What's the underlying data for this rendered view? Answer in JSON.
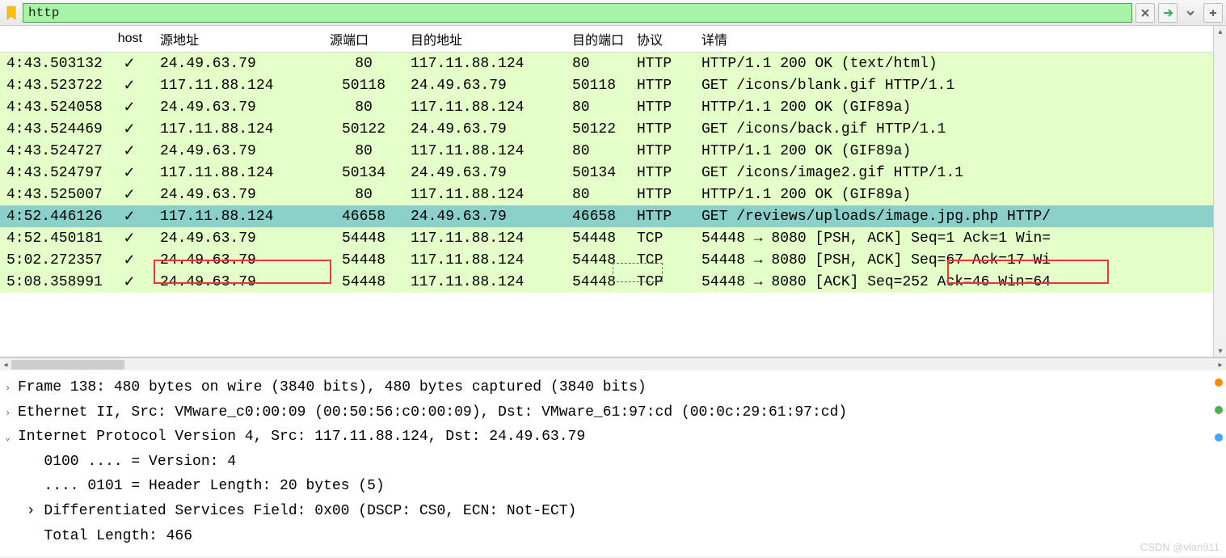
{
  "filter": {
    "value": "http"
  },
  "columns": {
    "time": "",
    "host": "host",
    "src": "源地址",
    "sport": "源端口",
    "dst": "目的地址",
    "dport": "目的端口",
    "proto": "协议",
    "info": "详情"
  },
  "packets": [
    {
      "time": "4:43.503132",
      "host": "✓",
      "src": "24.49.63.79",
      "sport": "80",
      "dst": "117.11.88.124",
      "dport": "80",
      "proto": "HTTP",
      "info": "HTTP/1.1 200 OK  (text/html)",
      "bg": "lightgreen"
    },
    {
      "time": "4:43.523722",
      "host": "✓",
      "src": "117.11.88.124",
      "sport": "50118",
      "dst": "24.49.63.79",
      "dport": "50118",
      "proto": "HTTP",
      "info": "GET /icons/blank.gif HTTP/1.1",
      "bg": "lightgreen"
    },
    {
      "time": "4:43.524058",
      "host": "✓",
      "src": "24.49.63.79",
      "sport": "80",
      "dst": "117.11.88.124",
      "dport": "80",
      "proto": "HTTP",
      "info": "HTTP/1.1 200 OK  (GIF89a)",
      "bg": "lightgreen"
    },
    {
      "time": "4:43.524469",
      "host": "✓",
      "src": "117.11.88.124",
      "sport": "50122",
      "dst": "24.49.63.79",
      "dport": "50122",
      "proto": "HTTP",
      "info": "GET /icons/back.gif HTTP/1.1",
      "bg": "lightgreen"
    },
    {
      "time": "4:43.524727",
      "host": "✓",
      "src": "24.49.63.79",
      "sport": "80",
      "dst": "117.11.88.124",
      "dport": "80",
      "proto": "HTTP",
      "info": "HTTP/1.1 200 OK  (GIF89a)",
      "bg": "lightgreen"
    },
    {
      "time": "4:43.524797",
      "host": "✓",
      "src": "117.11.88.124",
      "sport": "50134",
      "dst": "24.49.63.79",
      "dport": "50134",
      "proto": "HTTP",
      "info": "GET /icons/image2.gif HTTP/1.1",
      "bg": "lightgreen"
    },
    {
      "time": "4:43.525007",
      "host": "✓",
      "src": "24.49.63.79",
      "sport": "80",
      "dst": "117.11.88.124",
      "dport": "80",
      "proto": "HTTP",
      "info": "HTTP/1.1 200 OK  (GIF89a)",
      "bg": "lightgreen"
    },
    {
      "time": "4:52.446126",
      "host": "✓",
      "src": "117.11.88.124",
      "sport": "46658",
      "dst": "24.49.63.79",
      "dport": "46658",
      "proto": "HTTP",
      "info": "GET /reviews/uploads/image.jpg.php HTTP/",
      "bg": "selected"
    },
    {
      "time": "4:52.450181",
      "host": "✓",
      "src": "24.49.63.79",
      "sport": "54448",
      "dst": "117.11.88.124",
      "dport": "54448",
      "proto": "TCP",
      "info": "54448 → 8080 [PSH, ACK] Seq=1 Ack=1 Win=",
      "bg": "lightgreen"
    },
    {
      "time": "5:02.272357",
      "host": "✓",
      "src": "24.49.63.79",
      "sport": "54448",
      "dst": "117.11.88.124",
      "dport": "54448",
      "proto": "TCP",
      "info": "54448 → 8080 [PSH, ACK] Seq=67 Ack=17 Wi",
      "bg": "lightgreen"
    },
    {
      "time": "5:08.358991",
      "host": "✓",
      "src": "24.49.63.79",
      "sport": "54448",
      "dst": "117.11.88.124",
      "dport": "54448",
      "proto": "TCP",
      "info": "54448 → 8080 [ACK] Seq=252 Ack=46 Win=64",
      "bg": "lightgreen"
    }
  ],
  "detail": {
    "frame": "Frame 138: 480 bytes on wire (3840 bits), 480 bytes captured (3840 bits)",
    "eth": "Ethernet II, Src: VMware_c0:00:09 (00:50:56:c0:00:09), Dst: VMware_61:97:cd (00:0c:29:61:97:cd)",
    "ip": "Internet Protocol Version 4, Src: 117.11.88.124, Dst: 24.49.63.79",
    "version": "0100 .... = Version: 4",
    "hlen": ".... 0101 = Header Length: 20 bytes (5)",
    "dscp": "Differentiated Services Field: 0x00 (DSCP: CS0, ECN: Not-ECT)",
    "tlen": "Total Length: 466"
  },
  "watermark": "CSDN @vlan911"
}
